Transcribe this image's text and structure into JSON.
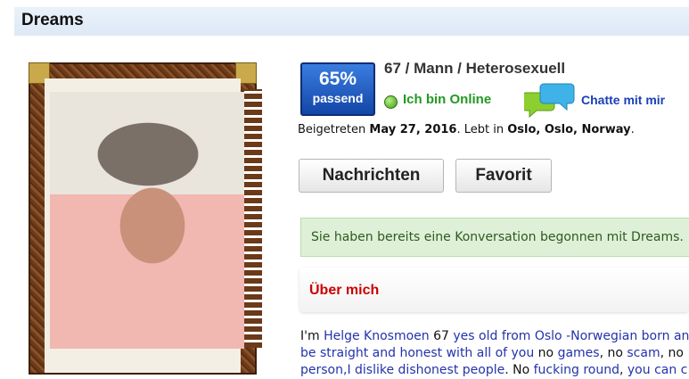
{
  "header": {
    "title": "Dreams"
  },
  "match": {
    "percent": "65%",
    "label": "passend"
  },
  "profile": {
    "summary": "67 / Mann / Heterosexuell",
    "online_status": "Ich bin Online",
    "chat_label": "Chatte mit mir",
    "joined_prefix": "Beigetreten",
    "joined_date": "May 27, 2016",
    "location_prefix": ". Lebt in",
    "location": "Oslo, Oslo, Norway",
    "location_suffix": "."
  },
  "actions": {
    "messages_label": "Nachrichten",
    "favorite_label": "Favorit"
  },
  "notice": {
    "text": "Sie haben bereits eine Konversation begonnen mit Dreams."
  },
  "about": {
    "title": "Über mich",
    "line1": [
      {
        "t": "I'm ",
        "c": "plain"
      },
      {
        "t": "Helge Knosmoen",
        "c": "blue"
      },
      {
        "t": " 67 ",
        "c": "plain"
      },
      {
        "t": "yes old from Oslo -Norwegian born an",
        "c": "blue"
      }
    ],
    "line2": [
      {
        "t": "be straight and honest with all of you",
        "c": "blue"
      },
      {
        "t": " no ",
        "c": "plain"
      },
      {
        "t": "games",
        "c": "blue"
      },
      {
        "t": ", no ",
        "c": "plain"
      },
      {
        "t": "scam",
        "c": "blue"
      },
      {
        "t": ", no",
        "c": "plain"
      }
    ],
    "line3": [
      {
        "t": "person,I dislike dishonest people",
        "c": "blue"
      },
      {
        "t": ". No ",
        "c": "plain"
      },
      {
        "t": "fucking round",
        "c": "blue"
      },
      {
        "t": ", ",
        "c": "plain"
      },
      {
        "t": "you can c",
        "c": "blue"
      }
    ]
  },
  "icons": {
    "online": "online-status-icon",
    "chat": "chat-bubbles-icon"
  },
  "colors": {
    "accent_blue": "#1346a8",
    "online_green": "#229922",
    "section_red": "#cc0000",
    "notice_bg": "#dff0d8"
  }
}
